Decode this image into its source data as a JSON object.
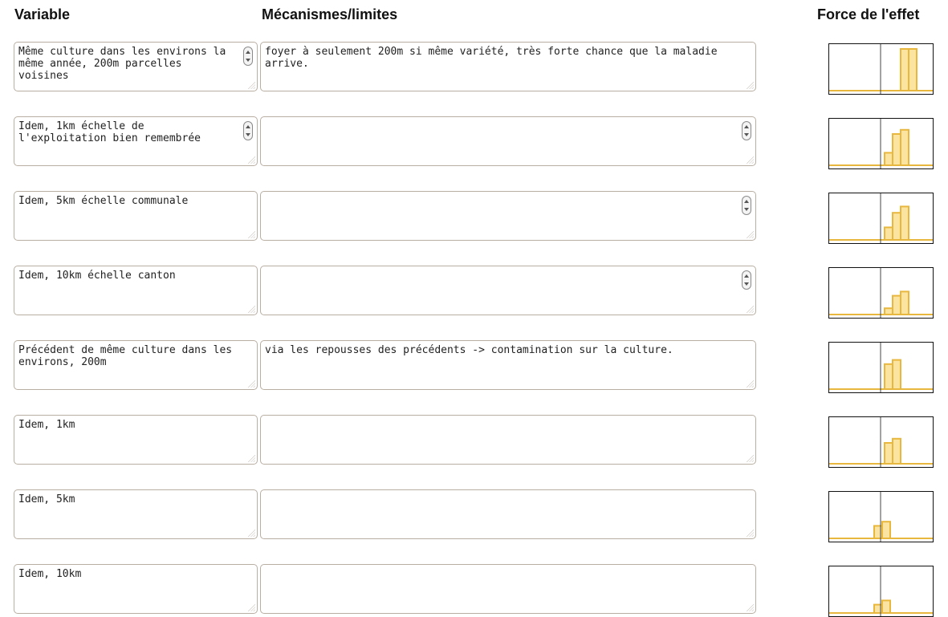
{
  "headers": {
    "variable": "Variable",
    "mechanisms": "Mécanismes/limites",
    "effect": "Force de l'effet"
  },
  "colors": {
    "bar_fill": "#fbe3a2",
    "bar_stroke": "#e8b83e",
    "axis_line": "#444444",
    "border": "#b8aea2"
  },
  "rows": [
    {
      "variable": "Même culture dans les environs la même année, 200m parcelles voisines",
      "mechanism": "foyer à seulement 200m si même variété, très forte chance que la maladie arrive.",
      "chart_data": {
        "type": "bar",
        "values": [
          0,
          0,
          1.0,
          1.0
        ]
      }
    },
    {
      "variable": "Idem, 1km échelle de l'exploitation bien remembrée",
      "mechanism": "",
      "chart_data": {
        "type": "bar",
        "values": [
          0.3,
          0.75,
          0.85,
          0
        ]
      }
    },
    {
      "variable": "Idem, 5km échelle communale",
      "mechanism": "",
      "chart_data": {
        "type": "bar",
        "values": [
          0.3,
          0.65,
          0.8,
          0
        ]
      }
    },
    {
      "variable": "Idem, 10km échelle canton",
      "mechanism": "",
      "chart_data": {
        "type": "bar",
        "values": [
          0.15,
          0.45,
          0.55,
          0
        ]
      }
    },
    {
      "variable": "Précédent de même culture dans les environs, 200m",
      "mechanism": "via les repousses des précédents -> contamination sur la culture.",
      "chart_data": {
        "type": "bar",
        "values": [
          0.6,
          0.7,
          0,
          0
        ]
      }
    },
    {
      "variable": "Idem, 1km",
      "mechanism": "",
      "chart_data": {
        "type": "bar",
        "values": [
          0.5,
          0.6,
          0,
          0
        ]
      }
    },
    {
      "variable": "Idem, 5km",
      "mechanism": "",
      "chart_data": {
        "type": "bar",
        "values": [
          0.3,
          0.4,
          0,
          0
        ],
        "start": "left"
      }
    },
    {
      "variable": "Idem, 10km",
      "mechanism": "",
      "chart_data": {
        "type": "bar",
        "values": [
          0.2,
          0.3,
          0,
          0
        ],
        "start": "left"
      }
    }
  ]
}
